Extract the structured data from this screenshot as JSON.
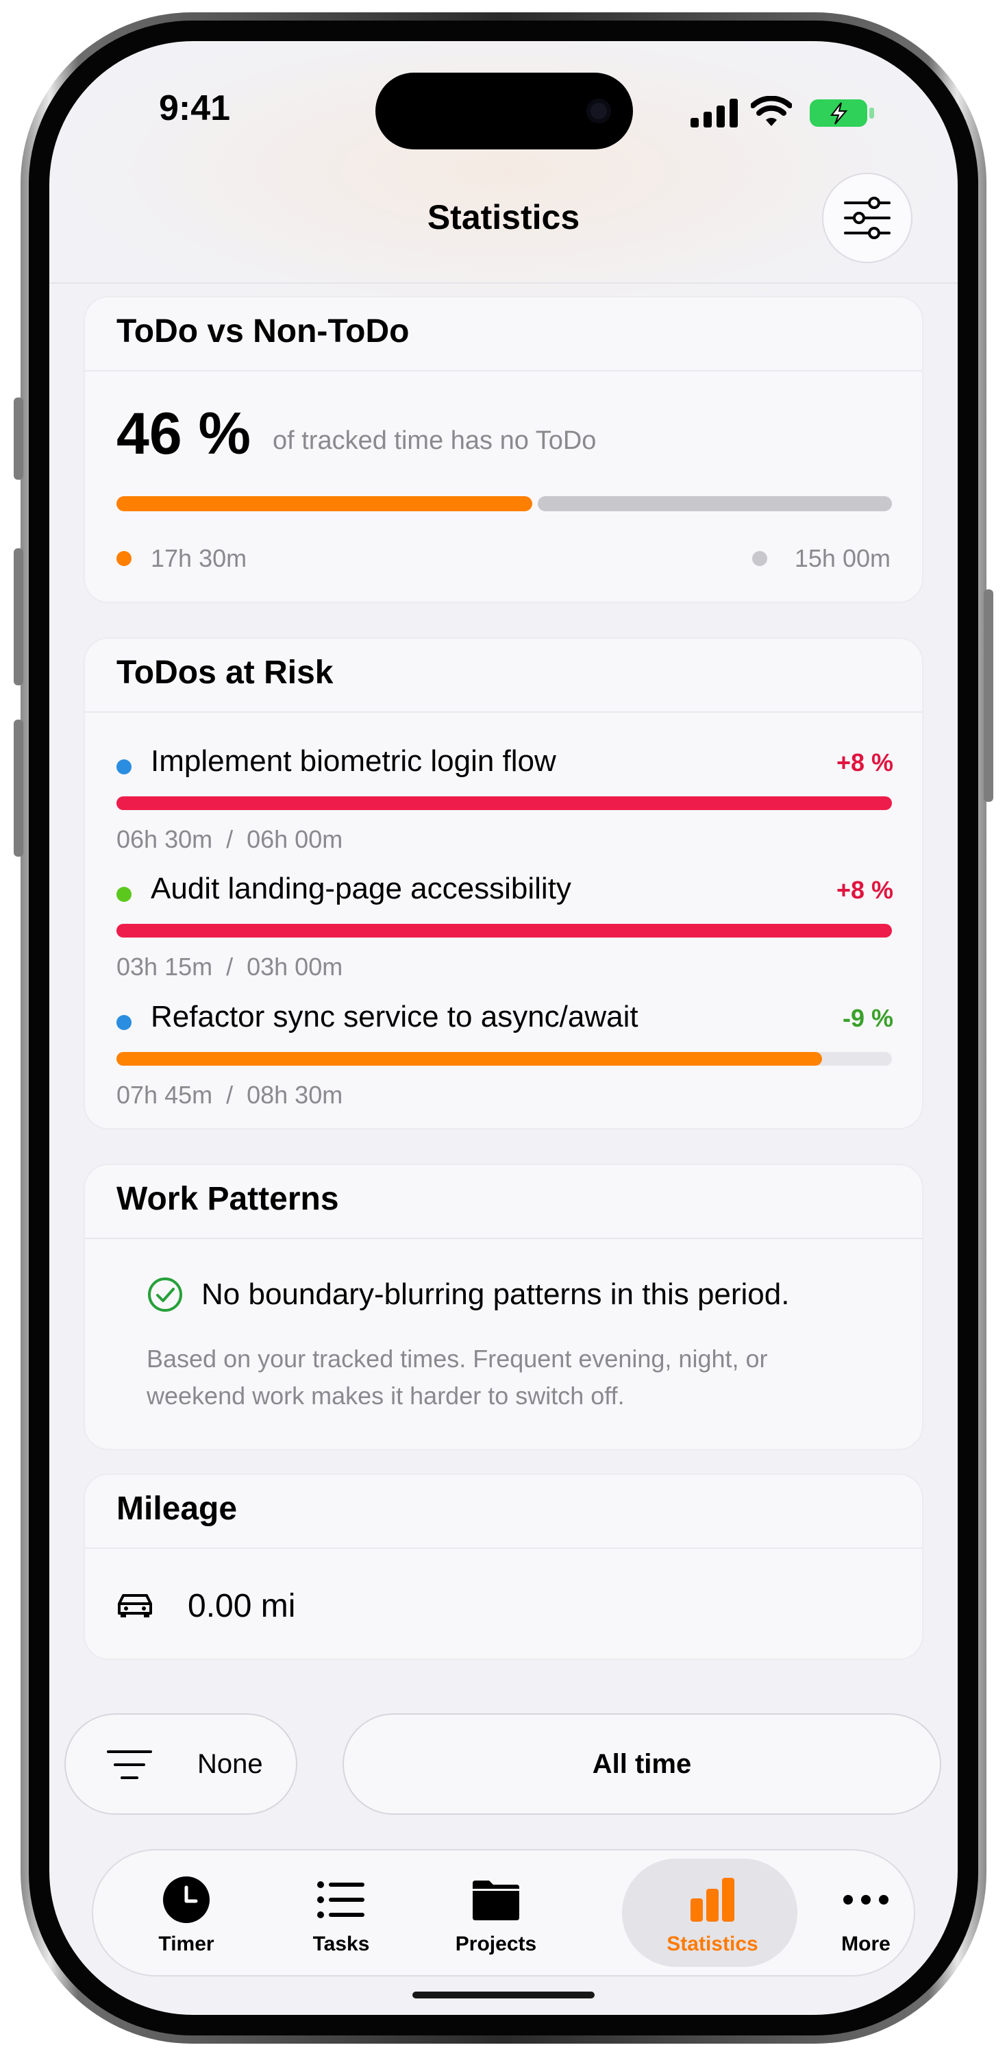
{
  "status_bar": {
    "time": "9:41"
  },
  "header": {
    "title": "Statistics",
    "filter_icon": "sliders-icon"
  },
  "todo_vs_non_todo": {
    "title": "ToDo vs Non-ToDo",
    "percent": "46 %",
    "caption": "of tracked time has no ToDo",
    "todo_fraction": 0.54,
    "todo_time": "17h 30m",
    "non_todo_time": "15h 00m",
    "colors": {
      "todo": "#ff7f00",
      "non_todo": "#c8c8cc"
    }
  },
  "todos_at_risk": {
    "title": "ToDos at Risk",
    "items": [
      {
        "name": "Implement biometric login flow",
        "delta": "+8 %",
        "times": "06h 30m  /  06h 00m",
        "progress": 1.0,
        "dot_color": "#2a8de0",
        "bar_color": "#ee1c4b",
        "delta_color": "#e0143f"
      },
      {
        "name": "Audit landing-page accessibility",
        "delta": "+8 %",
        "times": "03h 15m  /  03h 00m",
        "progress": 1.0,
        "dot_color": "#5cc81e",
        "bar_color": "#ee1c4b",
        "delta_color": "#e0143f"
      },
      {
        "name": "Refactor sync service to async/await",
        "delta": "-9 %",
        "times": "07h 45m  /  08h 30m",
        "progress": 0.91,
        "dot_color": "#2a8de0",
        "bar_color": "#ff8200",
        "delta_color": "#3aa12a"
      }
    ]
  },
  "work_patterns": {
    "title": "Work Patterns",
    "status_icon": "check-circle-icon",
    "status": "No boundary-blurring patterns in this period.",
    "note_line1": "Based on your tracked times. Frequent evening, night, or",
    "note_line2": "weekend work makes it harder to switch off."
  },
  "mileage": {
    "title": "Mileage",
    "icon": "car-icon",
    "value": "0.00 mi"
  },
  "filters": {
    "group_icon": "filter-lines-icon",
    "group_label": "None",
    "range_label": "All time"
  },
  "tabbar": {
    "active": "Statistics",
    "tabs": [
      {
        "label": "Timer",
        "icon": "clock-icon"
      },
      {
        "label": "Tasks",
        "icon": "list-icon"
      },
      {
        "label": "Projects",
        "icon": "folder-icon"
      },
      {
        "label": "Statistics",
        "icon": "bar-chart-icon"
      },
      {
        "label": "More",
        "icon": "ellipsis-icon"
      }
    ]
  }
}
